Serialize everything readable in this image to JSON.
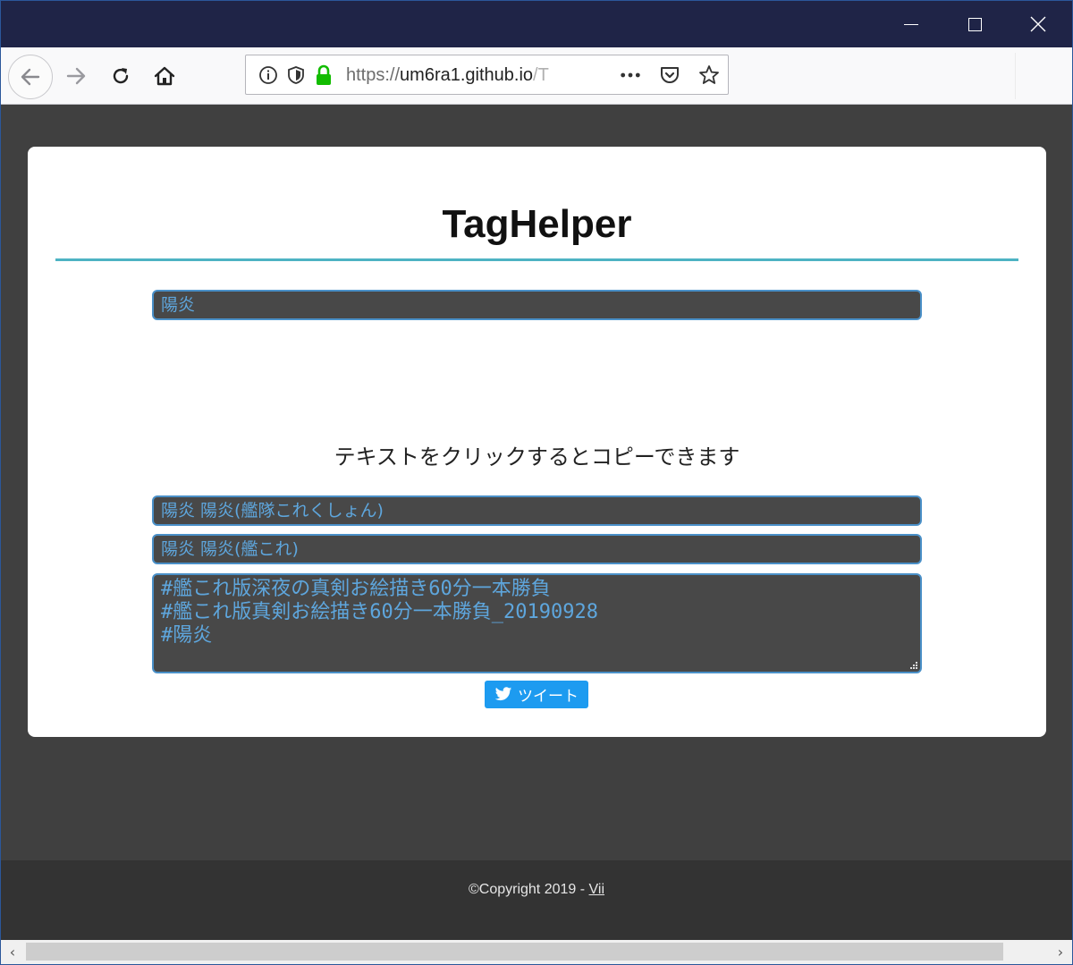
{
  "browser": {
    "window_controls": {
      "minimize_icon": "minimize-icon",
      "maximize_icon": "maximize-icon",
      "close_icon": "close-icon"
    },
    "url": {
      "protocol": "https://",
      "domain": "um6ra1.github.io",
      "path_fragment": "/T"
    }
  },
  "page": {
    "title": "TagHelper",
    "input_value": "陽炎",
    "instruction": "テキストをクリックするとコピーできます",
    "outputs": [
      "陽炎 陽炎(艦隊これくしょん)",
      "陽炎 陽炎(艦これ)"
    ],
    "hashtags": [
      "#艦これ版深夜の真剣お絵描き60分一本勝負",
      "#艦これ版真剣お絵描き60分一本勝負_20190928",
      "#陽炎"
    ],
    "tweet_label": "ツイート"
  },
  "footer": {
    "copyright": "©Copyright 2019 - ",
    "author_link": "Vii"
  },
  "colors": {
    "titlebar": "#1f2447",
    "page_bg": "#404040",
    "accent_rule": "#4db3c3",
    "field_bg": "#484848",
    "field_text": "#5ea6dd",
    "tweet": "#1d9bf0"
  }
}
